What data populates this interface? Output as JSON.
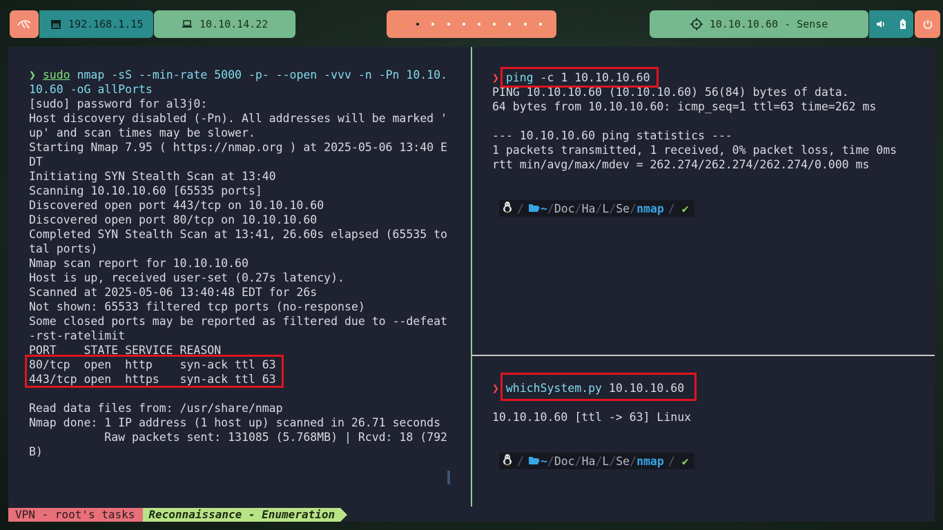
{
  "topbar": {
    "launcher_icon": "kali-dragon-icon",
    "local_ip": {
      "icon": "ethernet-icon",
      "value": "192.168.1.15"
    },
    "vpn_ip": {
      "icon": "laptop-icon",
      "value": "10.10.14.22"
    },
    "workspaces": {
      "count": 10,
      "active_index": 0,
      "current_index": 1
    },
    "target": {
      "icon": "crosshair-icon",
      "value": "10.10.10.60 - Sense"
    },
    "systray": {
      "volume_icon": "volume-icon",
      "battery_icon": "battery-icon"
    },
    "power_icon": "power-icon"
  },
  "left_pane": {
    "prompt_symbol": "❯",
    "command": {
      "sudo": "sudo",
      "rest": " nmap -sS --min-rate 5000 -p- --open -vvv -n -Pn 10.10.",
      "cont": "10.60 -oG allPorts"
    },
    "lines": [
      "[sudo] password for al3j0:",
      "Host discovery disabled (-Pn). All addresses will be marked '",
      "up' and scan times may be slower.",
      "Starting Nmap 7.95 ( https://nmap.org ) at 2025-05-06 13:40 E",
      "DT",
      "Initiating SYN Stealth Scan at 13:40",
      "Scanning 10.10.10.60 [65535 ports]",
      "Discovered open port 443/tcp on 10.10.10.60",
      "Discovered open port 80/tcp on 10.10.10.60",
      "Completed SYN Stealth Scan at 13:41, 26.60s elapsed (65535 to",
      "tal ports)",
      "Nmap scan report for 10.10.10.60",
      "Host is up, received user-set (0.27s latency).",
      "Scanned at 2025-05-06 13:40:48 EDT for 26s",
      "Not shown: 65533 filtered tcp ports (no-response)",
      "Some closed ports may be reported as filtered due to --defeat",
      "-rst-ratelimit",
      "PORT    STATE SERVICE REASON",
      "80/tcp  open  http    syn-ack ttl 63",
      "443/tcp open  https   syn-ack ttl 63",
      "",
      "Read data files from: /usr/share/nmap",
      "Nmap done: 1 IP address (1 host up) scanned in 26.71 seconds",
      "           Raw packets sent: 131085 (5.768MB) | Rcvd: 18 (792",
      "B)"
    ]
  },
  "right_top_pane": {
    "prompt_symbol": "❯",
    "cmd": "ping",
    "args": " -c 1 10.10.10.60",
    "lines": [
      "PING 10.10.10.60 (10.10.10.60) 56(84) bytes of data.",
      "64 bytes from 10.10.10.60: icmp_seq=1 ttl=63 time=262 ms",
      "",
      "--- 10.10.10.60 ping statistics ---",
      "1 packets transmitted, 1 received, 0% packet loss, time 0ms",
      "rtt min/avg/max/mdev = 262.274/262.274/262.274/0.000 ms"
    ]
  },
  "right_bottom_pane": {
    "prompt_symbol": "❯",
    "cmd": "whichSystem.py",
    "args": " 10.10.10.60",
    "lines": [
      "",
      "10.10.10.60 [ttl -> 63] Linux"
    ]
  },
  "pathbar": {
    "os_icon": "linux-tux-icon",
    "folder_icon": "folder-open-icon",
    "home": "~",
    "segments": [
      "Doc",
      "Ha",
      "L",
      "Se"
    ],
    "current": "nmap",
    "status_icon": "check-icon",
    "check": "✔"
  },
  "statusbar": {
    "session": "VPN - root's tasks",
    "window": "Reconnaissance - Enumeration"
  }
}
